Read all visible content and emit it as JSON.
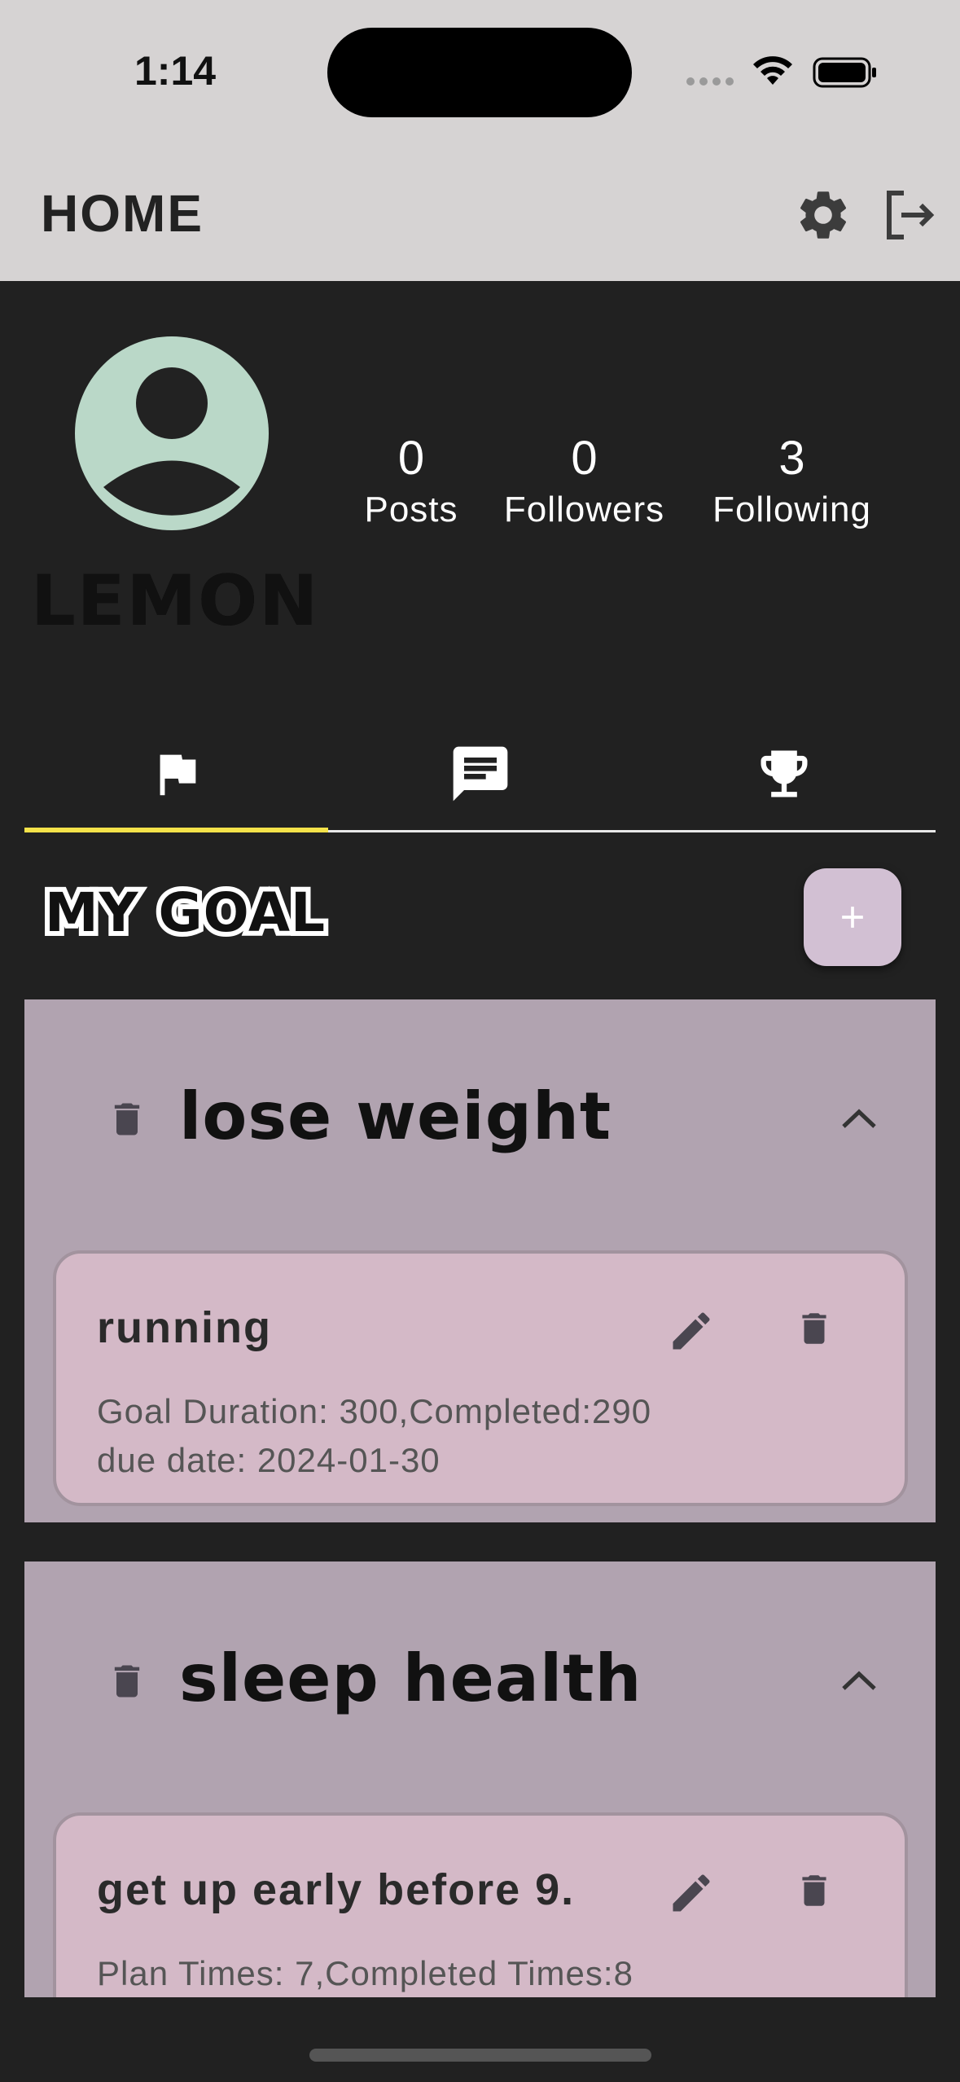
{
  "status_bar": {
    "time": "1:14"
  },
  "appbar": {
    "title": "HOME",
    "settings_icon": "gear-icon",
    "logout_icon": "logout-icon"
  },
  "profile": {
    "username": "LEMON",
    "stats": [
      {
        "value": "0",
        "label": "Posts"
      },
      {
        "value": "0",
        "label": "Followers"
      },
      {
        "value": "3",
        "label": "Following"
      }
    ]
  },
  "tabs": [
    {
      "icon": "flag-icon",
      "selected": true
    },
    {
      "icon": "message-icon",
      "selected": false
    },
    {
      "icon": "trophy-icon",
      "selected": false
    }
  ],
  "goals_section": {
    "title": "MY GOAL",
    "add_icon": "plus-icon",
    "categories": [
      {
        "title": "lose weight",
        "items": [
          {
            "title": "running",
            "line1": "Goal Duration: 300,Completed:290",
            "line2": "due date: 2024-01-30"
          }
        ]
      },
      {
        "title": "sleep health",
        "items": [
          {
            "title": "get up early before 9.",
            "line1": "Plan Times: 7,Completed Times:8"
          }
        ]
      }
    ]
  },
  "colors": {
    "background": "#212121",
    "appbar": "#d6d3d3",
    "tab_indicator": "#f4e24a",
    "category_bg": "#b1a3b0",
    "card_bg": "#d4b9c7",
    "add_button": "#d2c0d3",
    "avatar": "#bad8c8"
  }
}
